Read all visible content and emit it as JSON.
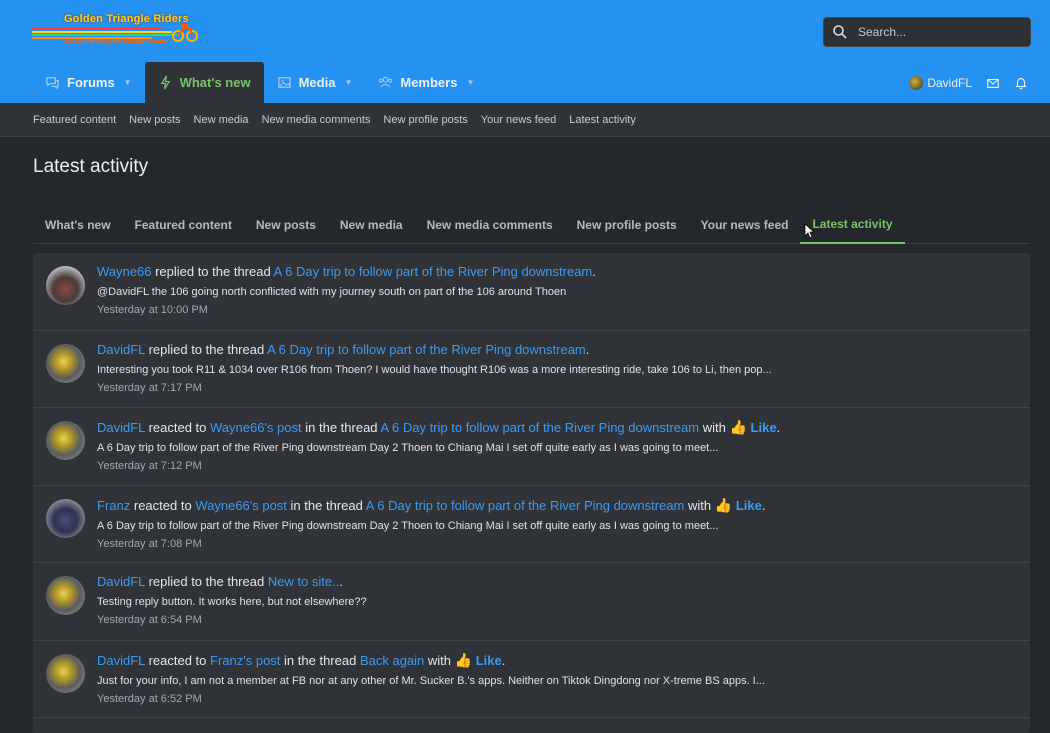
{
  "site": {
    "logo_title": "Golden Triangle Riders",
    "logo_subtitle": "S.E Asia Motorcycle Touring Forums"
  },
  "search": {
    "placeholder": "Search..."
  },
  "nav": {
    "tabs": [
      {
        "label": "Forums",
        "icon": "comments-icon",
        "has_caret": true
      },
      {
        "label": "What's new",
        "icon": "bolt-icon",
        "has_caret": false,
        "active": true
      },
      {
        "label": "Media",
        "icon": "image-icon",
        "has_caret": true
      },
      {
        "label": "Members",
        "icon": "users-icon",
        "has_caret": true
      }
    ]
  },
  "user": {
    "name": "DavidFL"
  },
  "subnav": {
    "items": [
      "Featured content",
      "New posts",
      "New media",
      "New media comments",
      "New profile posts",
      "Your news feed",
      "Latest activity"
    ]
  },
  "page": {
    "title": "Latest activity"
  },
  "tabs": {
    "items": [
      "What's new",
      "Featured content",
      "New posts",
      "New media",
      "New media comments",
      "New profile posts",
      "Your news feed",
      "Latest activity"
    ],
    "active": "Latest activity"
  },
  "colors": {
    "header": "#2591f0",
    "accent_green": "#7ac36a",
    "link": "#3c9bf2",
    "background": "#24272c"
  },
  "activity": [
    {
      "user": "Wayne66",
      "action": "replied to the thread",
      "thread": "A 6 Day trip to follow part of the River Ping downstream",
      "end": ".",
      "snippet": "@DavidFL the 106 going north conflicted with my journey south on part of the 106 around Thoen",
      "time": "Yesterday at 10:00 PM"
    },
    {
      "user": "DavidFL",
      "action": "replied to the thread",
      "thread": "A 6 Day trip to follow part of the River Ping downstream",
      "end": ".",
      "snippet": "Interesting you took R11 & 1034 over R106 from Thoen? I would have thought R106 was a more interesting ride, take 106 to Li, then pop...",
      "time": "Yesterday at 7:17 PM"
    },
    {
      "user": "DavidFL",
      "action": "reacted to",
      "post_owner": "Wayne66's post",
      "mid": "in the thread",
      "thread": "A 6 Day trip to follow part of the River Ping downstream",
      "with": "with",
      "reaction": "Like",
      "end": ".",
      "snippet": "A 6 Day trip to follow part of the River Ping downstream Day 2 Thoen to Chiang Mai I set off quite early as I was going to meet...",
      "time": "Yesterday at 7:12 PM"
    },
    {
      "user": "Franz",
      "action": "reacted to",
      "post_owner": "Wayne66's post",
      "mid": "in the thread",
      "thread": "A 6 Day trip to follow part of the River Ping downstream",
      "with": "with",
      "reaction": "Like",
      "end": ".",
      "snippet": "A 6 Day trip to follow part of the River Ping downstream Day 2 Thoen to Chiang Mai I set off quite early as I was going to meet...",
      "time": "Yesterday at 7:08 PM"
    },
    {
      "user": "DavidFL",
      "action": "replied to the thread",
      "thread": "New to site..",
      "end": ".",
      "snippet": "Testing reply button. It works here, but not elsewhere??",
      "time": "Yesterday at 6:54 PM"
    },
    {
      "user": "DavidFL",
      "action": "reacted to",
      "post_owner": "Franz's post",
      "mid": "in the thread",
      "thread": "Back again",
      "with": "with",
      "reaction": "Like",
      "end": ".",
      "snippet": "Just for your info, I am not a member at FB nor at any other of Mr. Sucker B.'s apps. Neither on Tiktok Dingdong nor X-treme BS apps. I...",
      "time": "Yesterday at 6:52 PM"
    }
  ]
}
